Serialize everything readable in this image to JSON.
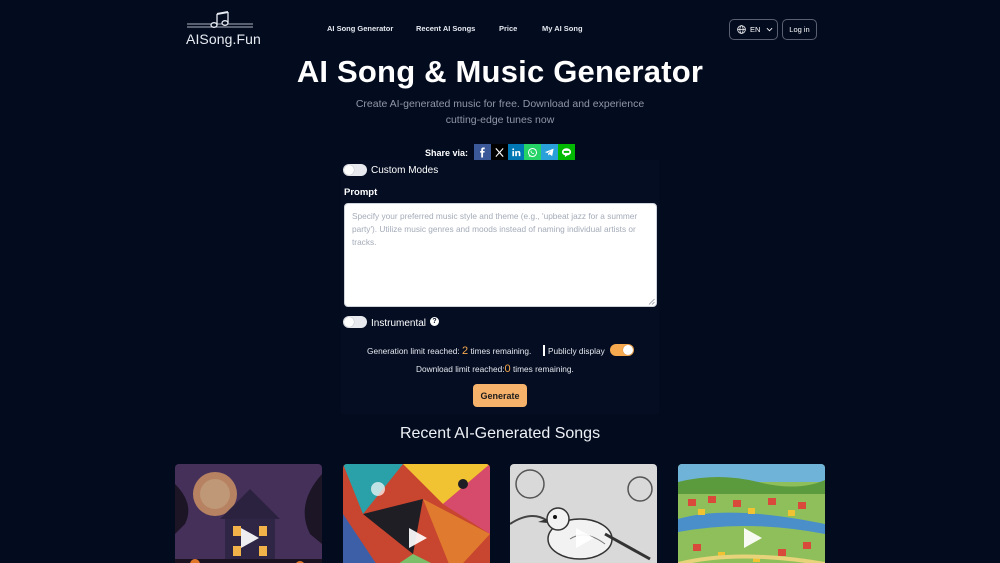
{
  "header": {
    "logo_text": "AISong.Fun",
    "nav": [
      "AI Song Generator",
      "Recent AI Songs",
      "Price",
      "My AI Song"
    ],
    "lang_label": "EN",
    "login_label": "Log in"
  },
  "hero": {
    "title": "AI Song & Music Generator",
    "subtitle_line1": "Create AI-generated music for free. Download and experience",
    "subtitle_line2": "cutting-edge tunes now"
  },
  "share": {
    "label": "Share via:",
    "networks": [
      "facebook-icon",
      "x-icon",
      "linkedin-icon",
      "whatsapp-icon",
      "telegram-icon",
      "line-icon"
    ]
  },
  "form": {
    "custom_modes_label": "Custom Modes",
    "prompt_label": "Prompt",
    "prompt_placeholder": "Specify your preferred music style and theme (e.g., 'upbeat jazz for a summer party').   Utilize music genres and moods instead of naming individual artists or tracks.",
    "instrumental_label": "Instrumental",
    "help_glyph": "?",
    "gen_limit_prefix": "Generation limit reached: ",
    "gen_limit_num": "2",
    "gen_limit_suffix": " times remaining.",
    "publicly_display_label": "Publicly display",
    "dl_limit_prefix": "Download limit reached:",
    "dl_limit_num": "0",
    "dl_limit_suffix": " times remaining.",
    "generate_label": "Generate"
  },
  "recent": {
    "title": "Recent AI-Generated Songs"
  },
  "colors": {
    "background": "#030b1e",
    "accent": "#f6b26b",
    "accent_number": "#f6a94e"
  }
}
